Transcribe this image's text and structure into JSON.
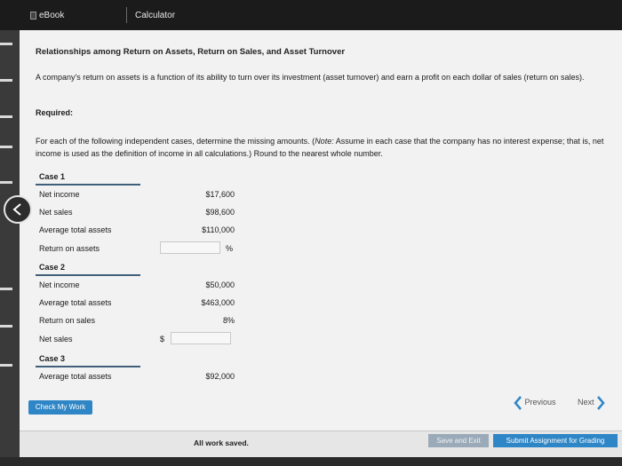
{
  "tabs": {
    "ebook": "eBook",
    "calculator": "Calculator"
  },
  "title": "Relationships among Return on Assets, Return on Sales, and Asset Turnover",
  "intro": "A company's return on assets is a function of its ability to turn over its investment (asset turnover) and earn a profit on each dollar of sales (return on sales).",
  "required_label": "Required:",
  "instructions": {
    "before_note": "For each of the following independent cases, determine the missing amounts. (",
    "note": "Note:",
    "after_note": " Assume in each case that the company has no interest expense; that is, net income is used as the definition of income in all calculations.) Round to the nearest whole number."
  },
  "case1": {
    "label": "Case 1",
    "rows": [
      {
        "label": "Net income",
        "value": "$17,600"
      },
      {
        "label": "Net sales",
        "value": "$98,600"
      },
      {
        "label": "Average total assets",
        "value": "$110,000"
      },
      {
        "label": "Return on assets",
        "value": "",
        "unit": "%"
      }
    ]
  },
  "case2": {
    "label": "Case 2",
    "rows": [
      {
        "label": "Net income",
        "value": "$50,000"
      },
      {
        "label": "Average total assets",
        "value": "$463,000"
      },
      {
        "label": "Return on sales",
        "value": "8%"
      },
      {
        "label": "Net sales",
        "value": "",
        "unit": "$"
      }
    ]
  },
  "case3": {
    "label": "Case 3",
    "rows": [
      {
        "label": "Average total assets",
        "value": "$92,000"
      }
    ]
  },
  "buttons": {
    "check": "Check My Work",
    "previous": "Previous",
    "next": "Next",
    "save_exit": "Save and Exit",
    "submit": "Submit Assignment for Grading"
  },
  "status": "All work saved."
}
